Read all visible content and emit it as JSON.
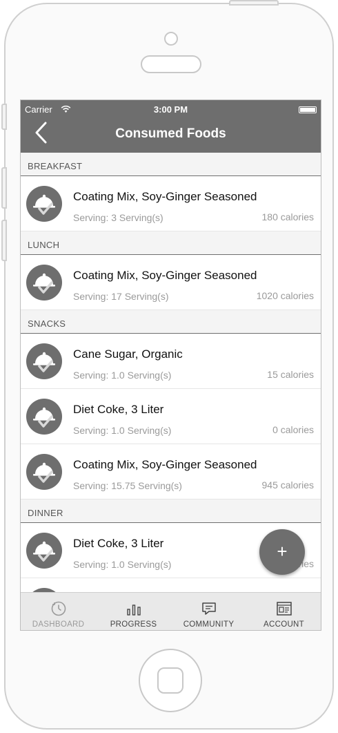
{
  "status_bar": {
    "carrier": "Carrier",
    "time": "3:00 PM"
  },
  "header": {
    "title": "Consumed Foods"
  },
  "sections": [
    {
      "label": "BREAKFAST",
      "items": [
        {
          "name": "Coating Mix, Soy-Ginger Seasoned",
          "serving": "Serving: 3 Serving(s)",
          "calories": "180 calories"
        }
      ]
    },
    {
      "label": "LUNCH",
      "items": [
        {
          "name": "Coating Mix, Soy-Ginger Seasoned",
          "serving": "Serving: 17 Serving(s)",
          "calories": "1020 calories"
        }
      ]
    },
    {
      "label": "SNACKS",
      "items": [
        {
          "name": "Cane Sugar, Organic",
          "serving": "Serving: 1.0 Serving(s)",
          "calories": "15 calories"
        },
        {
          "name": "Diet Coke, 3 Liter",
          "serving": "Serving: 1.0 Serving(s)",
          "calories": "0 calories"
        },
        {
          "name": "Coating Mix, Soy-Ginger Seasoned",
          "serving": "Serving: 15.75 Serving(s)",
          "calories": "945 calories"
        }
      ]
    },
    {
      "label": "DINNER",
      "items": [
        {
          "name": "Diet Coke, 3 Liter",
          "serving": "Serving: 1.0 Serving(s)",
          "calories": "0 calories"
        }
      ]
    }
  ],
  "fab": {
    "label": "+"
  },
  "tabbar": {
    "items": [
      {
        "label": "DASHBOARD",
        "icon": "dashboard-icon"
      },
      {
        "label": "PROGRESS",
        "icon": "bar-chart-icon"
      },
      {
        "label": "COMMUNITY",
        "icon": "chat-icon"
      },
      {
        "label": "ACCOUNT",
        "icon": "account-card-icon"
      }
    ]
  },
  "colors": {
    "accent": "#6e6e6e",
    "section_bg": "#f4f4f4",
    "tabbar_bg": "#e9e9e9"
  }
}
